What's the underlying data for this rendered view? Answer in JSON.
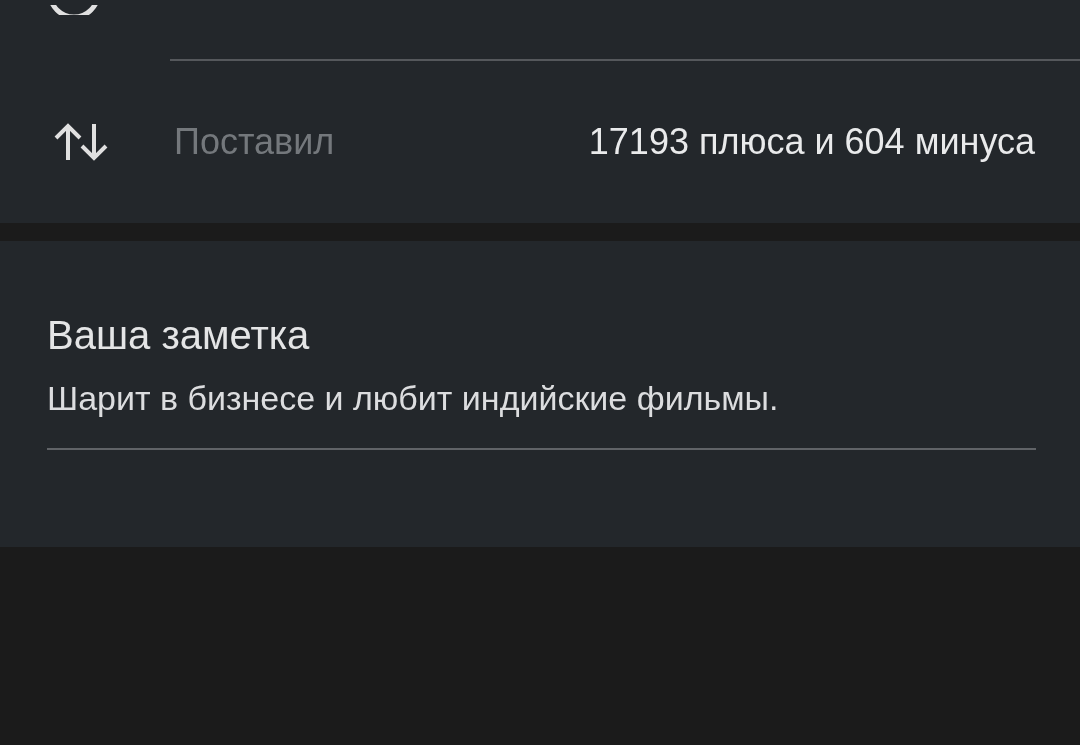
{
  "stats": [
    {
      "label": "Поставил",
      "value": "17193 плюса и 604 минуса"
    }
  ],
  "note": {
    "label": "Ваша заметка",
    "value": "Шарит в бизнесе и любит индийские фильмы."
  }
}
